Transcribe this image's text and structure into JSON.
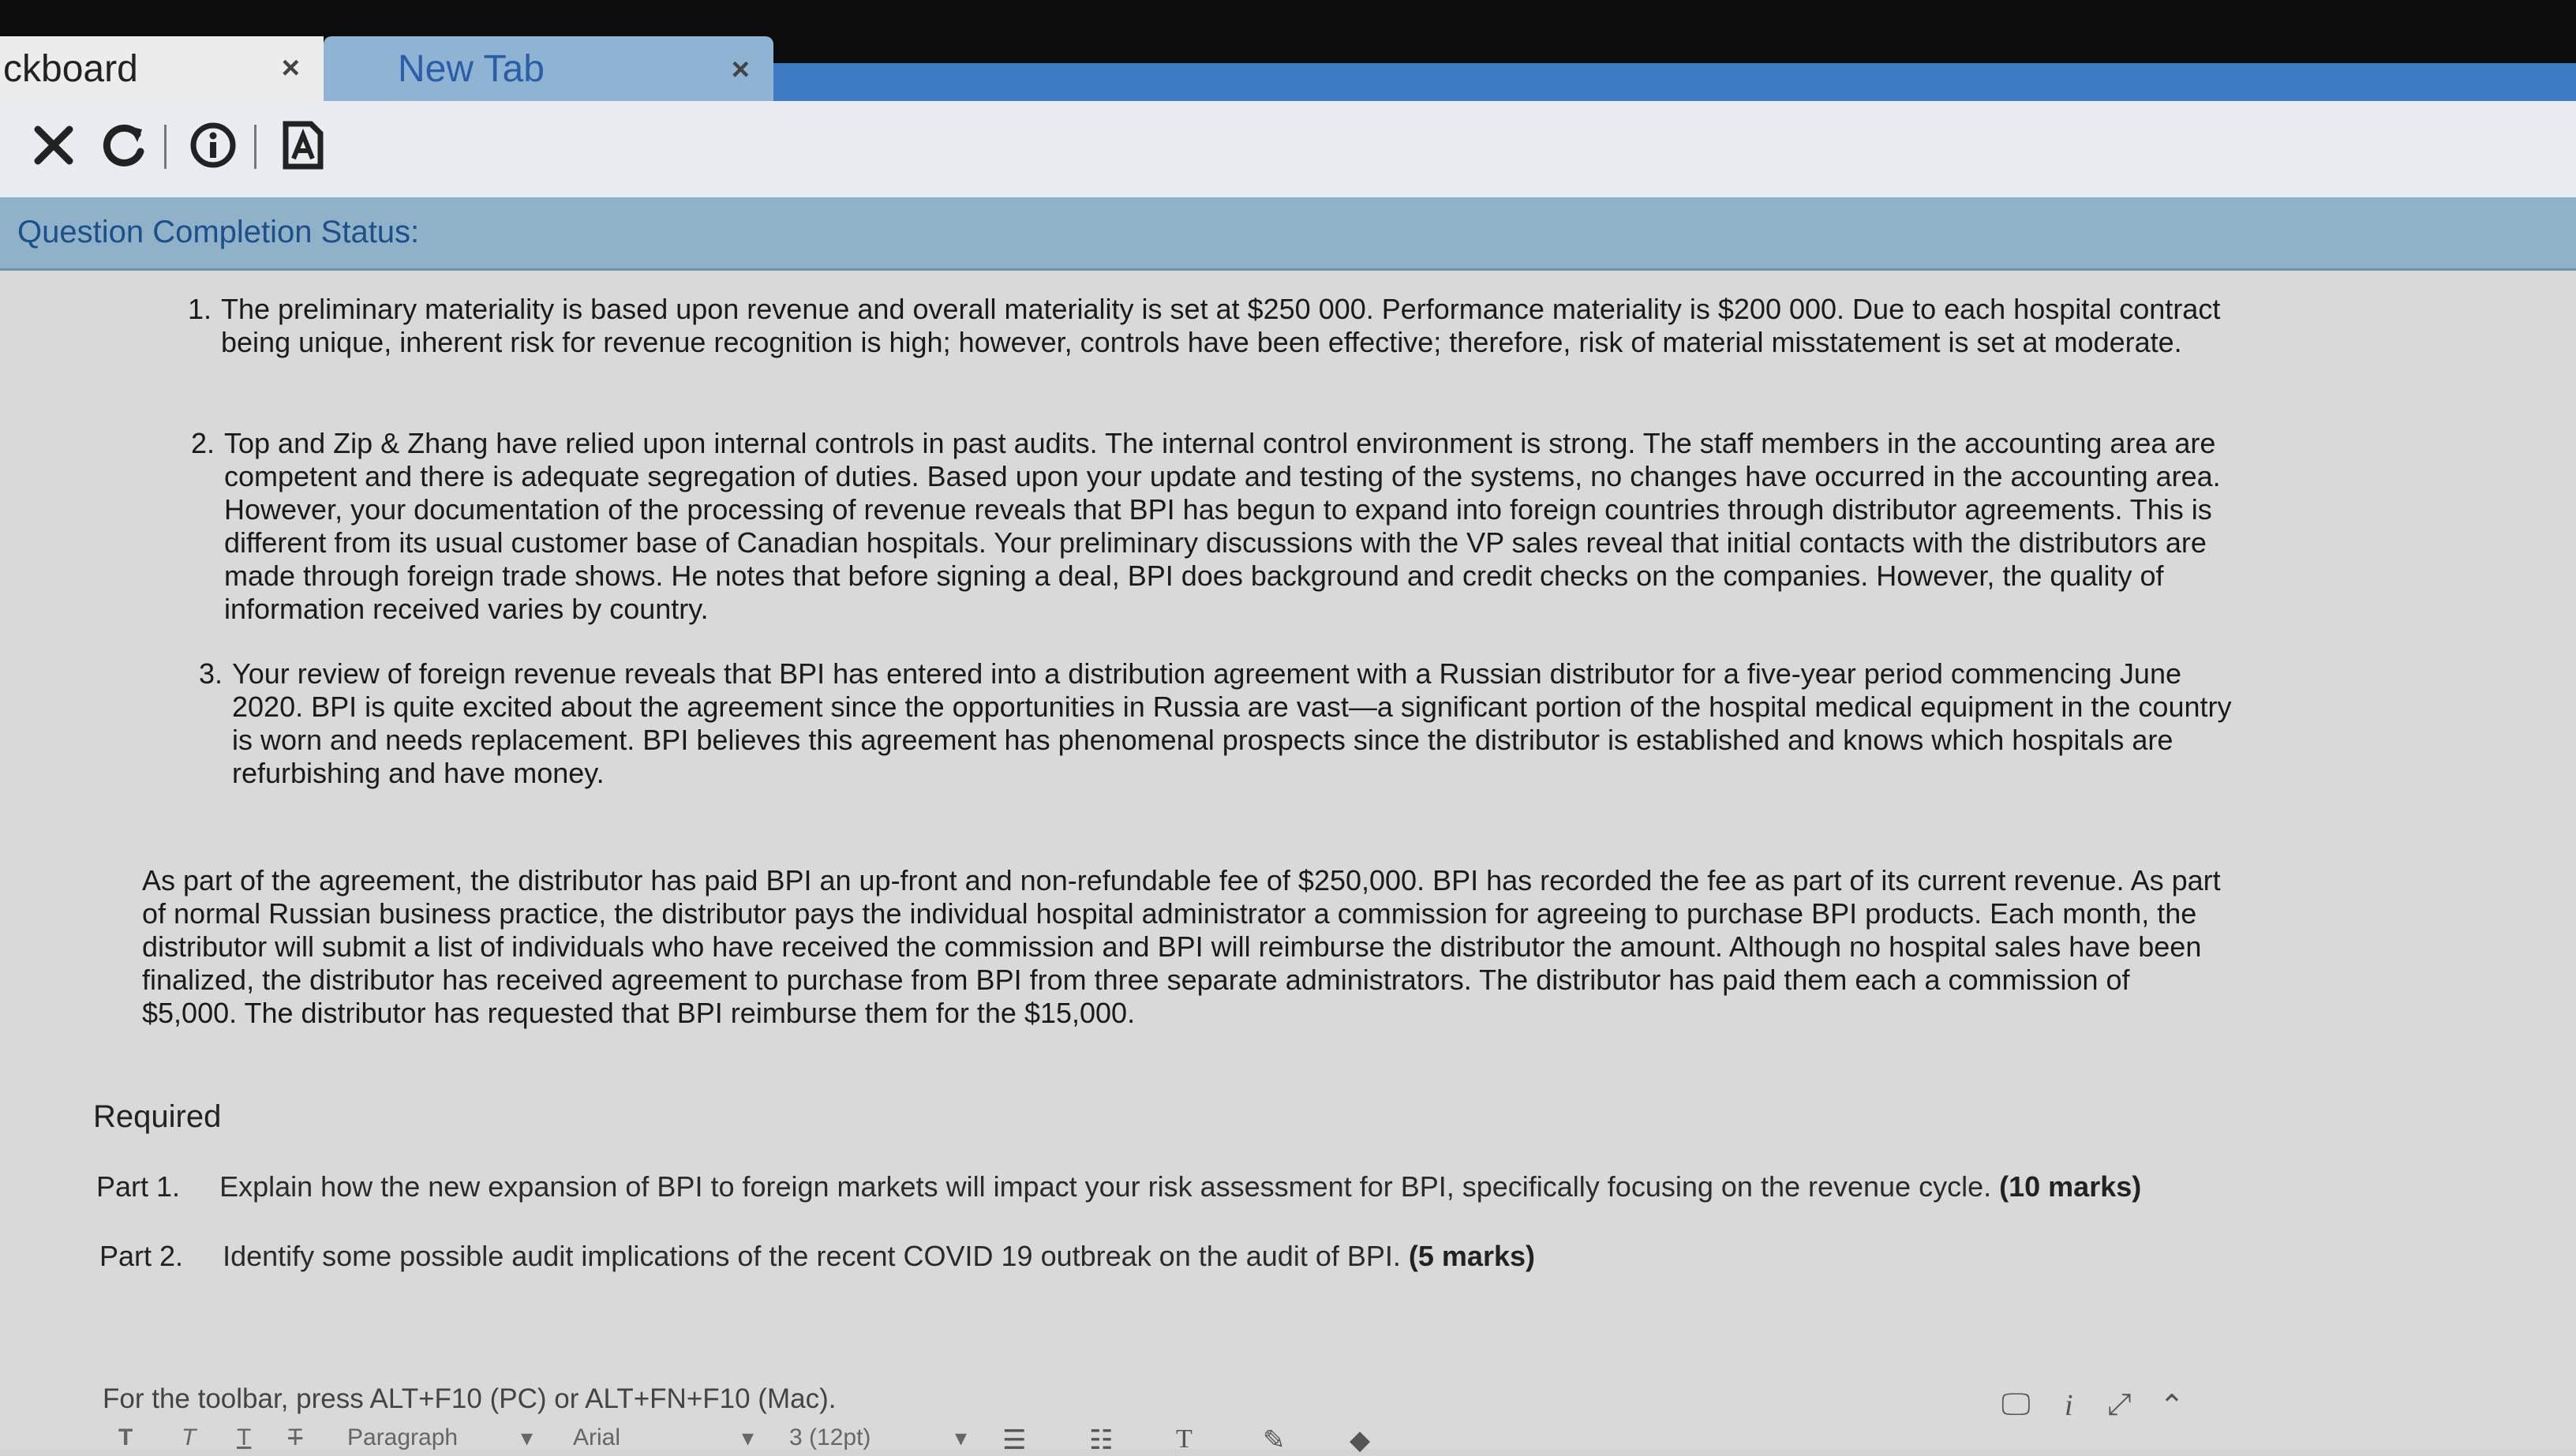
{
  "browser": {
    "tabs": [
      {
        "label": "ckboard",
        "close": "×"
      },
      {
        "label": "New Tab",
        "close": "×"
      }
    ]
  },
  "toolbar": {
    "stop": "✕",
    "reload": "↻",
    "info": "i",
    "reader": "A"
  },
  "status": {
    "label": "Question Completion Status:"
  },
  "questions": [
    {
      "num": "1.",
      "text": "The preliminary materiality is based upon revenue and overall materiality is set at $250 000. Performance materiality is $200 000. Due to each hospital contract being unique, inherent risk for revenue recognition is high; however, controls have been effective; therefore, risk of material misstatement is set at moderate."
    },
    {
      "num": "2.",
      "text": "Top and Zip & Zhang have relied upon internal controls in past audits. The internal control environment is strong. The staff members in the accounting area are competent and there is adequate segregation of duties. Based upon your update and testing of the systems, no changes have occurred in the accounting area. However, your documentation of the processing of revenue reveals that BPI has begun to expand into foreign countries through distributor agreements. This is different from its usual customer base of Canadian hospitals. Your preliminary discussions with the VP sales reveal that initial contacts with the distributors are made through foreign trade shows. He notes that before signing a deal, BPI does background and credit checks on the companies. However, the quality of information received varies by country."
    },
    {
      "num": "3.",
      "text": "Your review of foreign revenue reveals that BPI has entered into a distribution agreement with a Russian distributor for a five-year period commencing June 2020. BPI is quite excited about the agreement since the opportunities in Russia are vast—a significant portion of the hospital medical equipment in the country is worn and needs replacement. BPI believes this agreement has phenomenal prospects since the distributor is established and knows which hospitals are refurbishing and have money."
    }
  ],
  "paragraph": "As part of the agreement, the distributor has paid BPI an up-front and non-refundable fee of $250,000. BPI has recorded the fee as part of its current revenue. As part of normal Russian business practice, the distributor pays the individual hospital administrator a commission for agreeing to purchase BPI products. Each month, the distributor will submit a list of individuals who have received the commission and BPI will reimburse the distributor the amount. Although no hospital sales have been finalized, the distributor has received agreement to purchase from BPI from three separate administrators. The distributor has paid them each a commission of $5,000. The distributor has requested that BPI reimburse them for the $15,000.",
  "required": {
    "title": "Required",
    "parts": [
      {
        "label": "Part 1.",
        "text": "Explain how the new expansion of BPI to foreign markets will impact your risk assessment for BPI, specifically focusing on the revenue cycle.",
        "marks": "(10 marks)"
      },
      {
        "label": "Part 2.",
        "text": "Identify some possible audit implications of the recent COVID 19 outbreak on the audit of BPI.",
        "marks": "(5 marks)"
      }
    ]
  },
  "editor": {
    "hint": "For the toolbar, press ALT+F10 (PC) or ALT+FN+F10 (Mac).",
    "format_buttons": [
      "T",
      "T",
      "T",
      "T"
    ],
    "paragraph": "Paragraph",
    "font": "Arial",
    "size": "3 (12pt)"
  }
}
